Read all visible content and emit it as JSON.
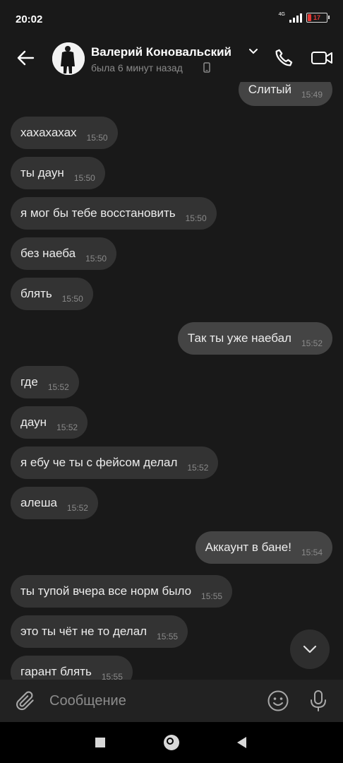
{
  "status_bar": {
    "time": "20:02",
    "network": "4G",
    "battery": "17"
  },
  "header": {
    "contact_name": "Валерий Коновальский",
    "last_seen": "была 6 минут назад",
    "icons": {
      "back": "arrow-left-icon",
      "call": "phone-icon",
      "video": "video-camera-icon",
      "device": "mobile-device-icon",
      "expand": "chevron-down-icon"
    }
  },
  "messages": [
    {
      "text": "Слитый",
      "time": "15:49",
      "direction": "out"
    },
    {
      "text": "хахахахах",
      "time": "15:50",
      "direction": "in"
    },
    {
      "text": "ты даун",
      "time": "15:50",
      "direction": "in"
    },
    {
      "text": "я мог бы тебе восстановить",
      "time": "15:50",
      "direction": "in"
    },
    {
      "text": "без наеба",
      "time": "15:50",
      "direction": "in"
    },
    {
      "text": "блять",
      "time": "15:50",
      "direction": "in"
    },
    {
      "text": "Так ты уже наебал",
      "time": "15:52",
      "direction": "out"
    },
    {
      "text": "где",
      "time": "15:52",
      "direction": "in"
    },
    {
      "text": "даун",
      "time": "15:52",
      "direction": "in"
    },
    {
      "text": "я ебу че ты с фейсом делал",
      "time": "15:52",
      "direction": "in"
    },
    {
      "text": "алеша",
      "time": "15:52",
      "direction": "in"
    },
    {
      "text": "Аккаунт в бане!",
      "time": "15:54",
      "direction": "out"
    },
    {
      "text": "ты тупой вчера все норм было",
      "time": "15:55",
      "direction": "in"
    },
    {
      "text": "это ты чёт не то делал",
      "time": "15:55",
      "direction": "in"
    },
    {
      "text": "гарант блять",
      "time": "15:55",
      "direction": "in"
    }
  ],
  "composer": {
    "placeholder": "Сообщение",
    "icons": {
      "attach": "paperclip-icon",
      "emoji": "smile-icon",
      "mic": "microphone-icon",
      "scroll": "chevron-down-icon"
    }
  },
  "colors": {
    "background": "#191919",
    "incoming_bubble": "#333333",
    "outgoing_bubble": "#444444",
    "battery_low": "#e53935"
  }
}
